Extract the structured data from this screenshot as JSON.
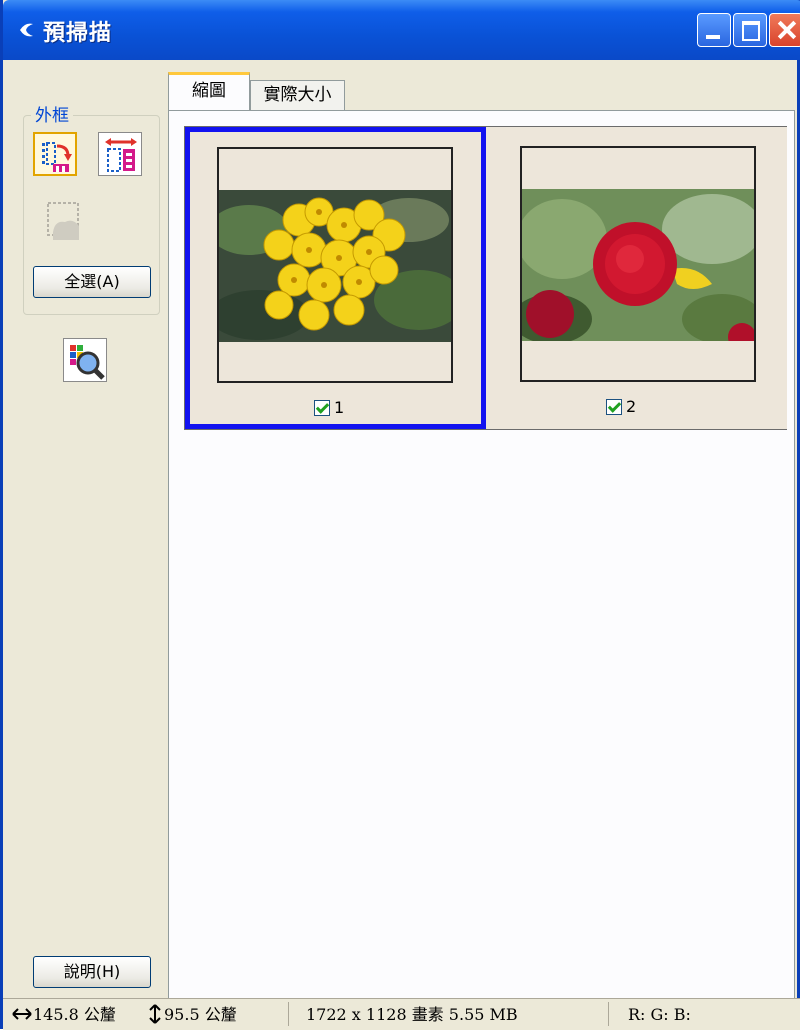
{
  "window": {
    "title": "預掃描"
  },
  "left_panel": {
    "frame_label": "外框",
    "select_all_label": "全選(A)",
    "help_label": "說明(H)"
  },
  "tabs": [
    {
      "label": "縮圖",
      "active": true
    },
    {
      "label": "實際大小",
      "active": false
    }
  ],
  "thumbnails": [
    {
      "number": "1",
      "checked": true,
      "selected": true,
      "subject": "yellow primrose flowers"
    },
    {
      "number": "2",
      "checked": true,
      "selected": false,
      "subject": "red ranunculus flower"
    }
  ],
  "status": {
    "width": "145.8 公釐",
    "height": "95.5 公釐",
    "size": "1722 x 1128 畫素 5.55 MB",
    "rgb": "R: G: B:"
  },
  "colors": {
    "selection_border": "#1212f0",
    "titlebar": "#0a52d6",
    "active_tab_highlight": "#ffc83c"
  }
}
